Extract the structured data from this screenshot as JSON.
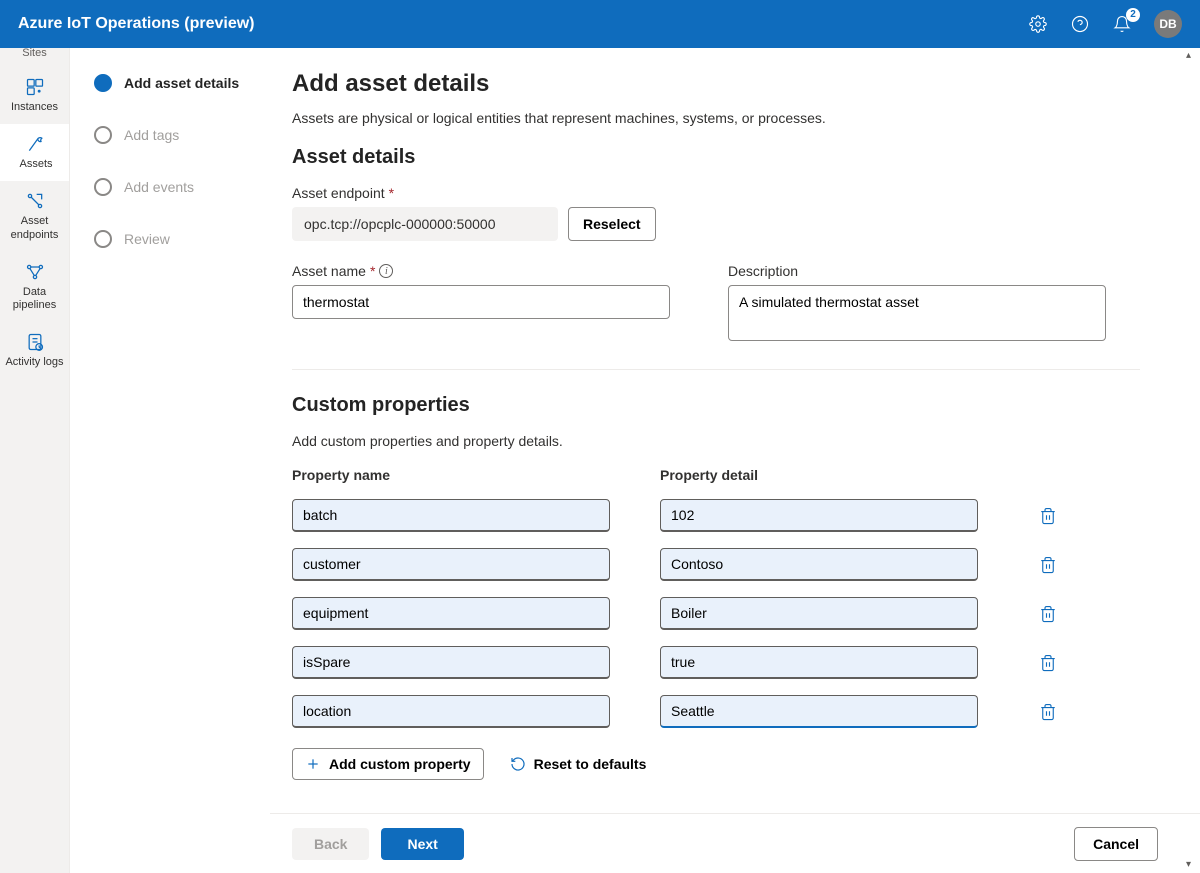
{
  "topbar": {
    "title": "Azure IoT Operations (preview)",
    "notification_count": "2",
    "avatar_initials": "DB"
  },
  "sidebar": {
    "truncated_label": "Sites",
    "items": [
      {
        "label": "Instances"
      },
      {
        "label": "Assets"
      },
      {
        "label": "Asset endpoints"
      },
      {
        "label": "Data pipelines"
      },
      {
        "label": "Activity logs"
      }
    ]
  },
  "wizard": {
    "steps": [
      "Add asset details",
      "Add tags",
      "Add events",
      "Review"
    ]
  },
  "page": {
    "heading": "Add asset details",
    "subheading": "Assets are physical or logical entities that represent machines, systems, or processes.",
    "section_asset_details": "Asset details",
    "label_endpoint": "Asset endpoint",
    "endpoint_value": "opc.tcp://opcplc-000000:50000",
    "reselect_label": "Reselect",
    "label_asset_name": "Asset name",
    "asset_name_value": "thermostat",
    "label_description": "Description",
    "description_value": "A simulated thermostat asset",
    "section_custom_props": "Custom properties",
    "custom_props_desc": "Add custom properties and property details.",
    "col_prop_name": "Property name",
    "col_prop_detail": "Property detail",
    "properties": [
      {
        "name": "batch",
        "detail": "102"
      },
      {
        "name": "customer",
        "detail": "Contoso"
      },
      {
        "name": "equipment",
        "detail": "Boiler"
      },
      {
        "name": "isSpare",
        "detail": "true"
      },
      {
        "name": "location",
        "detail": "Seattle"
      }
    ],
    "add_custom_label": "Add custom property",
    "reset_label": "Reset to defaults"
  },
  "footer": {
    "back": "Back",
    "next": "Next",
    "cancel": "Cancel"
  }
}
